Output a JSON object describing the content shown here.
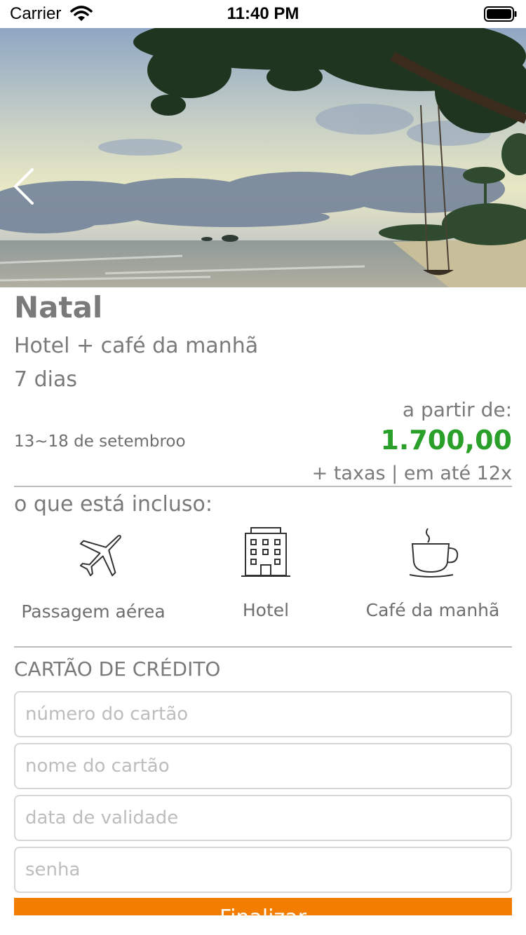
{
  "status_bar": {
    "carrier": "Carrier",
    "time": "11:40 PM",
    "wifi_icon": "wifi-icon",
    "battery_icon": "battery-icon"
  },
  "hero": {
    "image": "beach-with-swing-photo",
    "back_icon": "chevron-left-icon"
  },
  "package": {
    "title": "Natal",
    "subtitle": "Hotel + café da manhã",
    "duration": "7 dias",
    "dates": "13~18 de setembroo",
    "price_label": "a partir de:",
    "price": "1.700,00",
    "price_note": "+ taxas | em até 12x",
    "price_color": "#2aa02a"
  },
  "includes": {
    "title": "o que está incluso:",
    "items": [
      {
        "label": "Passagem aérea",
        "icon": "airplane-icon"
      },
      {
        "label": "Hotel",
        "icon": "hotel-building-icon"
      },
      {
        "label": "Café da manhã",
        "icon": "coffee-cup-icon"
      }
    ]
  },
  "credit_card": {
    "title": "CARTÃO DE CRÉDITO",
    "fields": [
      {
        "placeholder": "número do cartão",
        "value": ""
      },
      {
        "placeholder": "nome do cartão",
        "value": ""
      },
      {
        "placeholder": "data de validade",
        "value": ""
      },
      {
        "placeholder": "senha",
        "value": ""
      }
    ]
  },
  "finish_button": {
    "label": "Finalizar",
    "color": "#f27d00"
  }
}
